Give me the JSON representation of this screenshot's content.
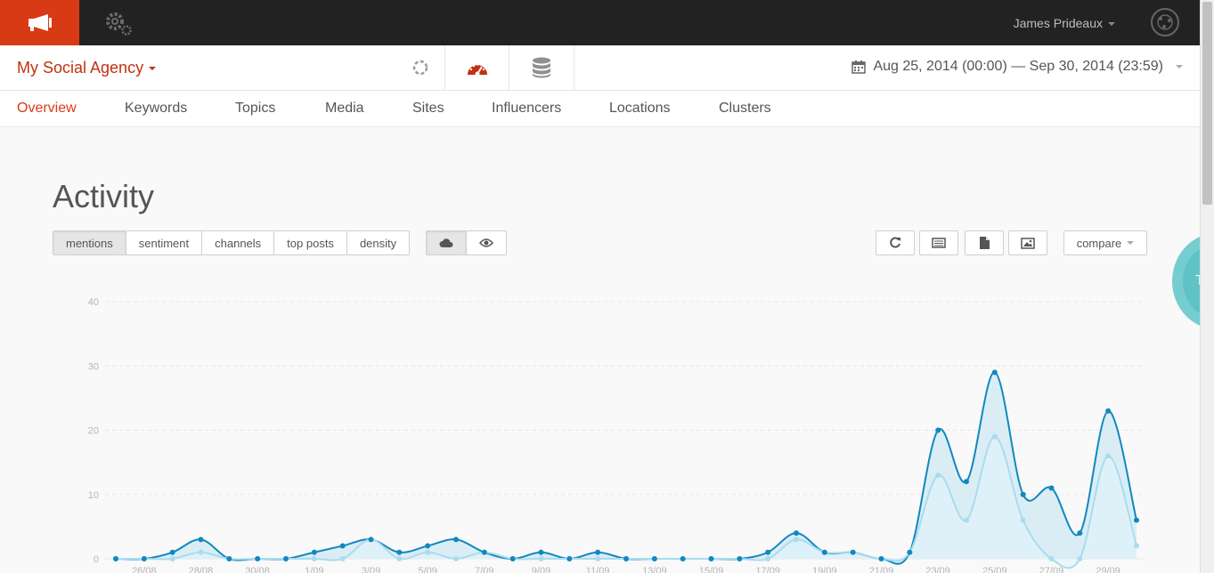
{
  "header": {
    "user_name": "James Prideaux"
  },
  "subheader": {
    "agency": "My Social Agency",
    "date_range": "Aug 25, 2014 (00:00) — Sep 30, 2014 (23:59)"
  },
  "tabs": [
    "Overview",
    "Keywords",
    "Topics",
    "Media",
    "Sites",
    "Influencers",
    "Locations",
    "Clusters"
  ],
  "main": {
    "title": "Activity",
    "view_buttons": [
      "mentions",
      "sentiment",
      "channels",
      "top posts",
      "density"
    ],
    "compare_label": "compare",
    "bubble_text": "TO"
  },
  "colors": {
    "brand": "#d83a16",
    "accent": "#c2310f",
    "series_main": "#1188bf",
    "series_light": "#a9dcee",
    "fill": "#d5ebf5"
  },
  "icons": {
    "brand": "megaphone-icon",
    "settings": "gear-icon",
    "loading": "spinner-icon",
    "dashboard": "gauge-icon",
    "database": "database-icon",
    "calendar": "calendar-icon",
    "cloud": "cloud-icon",
    "eye": "eye-icon",
    "refresh": "refresh-icon",
    "table": "table-icon",
    "document": "document-icon",
    "image": "image-icon"
  },
  "chart_data": {
    "type": "area",
    "ylim": [
      0,
      40
    ],
    "yticks": [
      0,
      10,
      20,
      30,
      40
    ],
    "grid": true,
    "x": [
      "25/08",
      "26/08",
      "27/08",
      "28/08",
      "29/08",
      "30/08",
      "31/08",
      "1/09",
      "2/09",
      "3/09",
      "4/09",
      "5/09",
      "6/09",
      "7/09",
      "8/09",
      "9/09",
      "10/09",
      "11/09",
      "12/09",
      "13/09",
      "14/09",
      "15/09",
      "16/09",
      "17/09",
      "18/09",
      "19/09",
      "20/09",
      "21/09",
      "22/09",
      "23/09",
      "24/09",
      "25/09",
      "26/09",
      "27/09",
      "28/09",
      "29/09",
      "30/09"
    ],
    "xtick_labels": [
      "26/08",
      "28/08",
      "30/08",
      "1/09",
      "3/09",
      "5/09",
      "7/09",
      "9/09",
      "11/09",
      "13/09",
      "15/09",
      "17/09",
      "19/09",
      "21/09",
      "23/09",
      "25/09",
      "27/09",
      "29/09"
    ],
    "series": [
      {
        "values": [
          0,
          0,
          1,
          3,
          0,
          0,
          0,
          1,
          2,
          3,
          1,
          2,
          3,
          1,
          0,
          1,
          0,
          1,
          0,
          0,
          0,
          0,
          0,
          1,
          4,
          1,
          1,
          0,
          1,
          20,
          12,
          29,
          10,
          11,
          4,
          23,
          6
        ]
      },
      {
        "values": [
          0,
          0,
          0,
          1,
          0,
          0,
          0,
          0,
          0,
          3,
          0,
          1,
          0,
          1,
          0,
          0,
          0,
          0,
          0,
          0,
          0,
          0,
          0,
          0,
          3,
          1,
          1,
          0,
          1,
          13,
          6,
          19,
          6,
          0,
          0,
          16,
          2
        ]
      }
    ]
  }
}
